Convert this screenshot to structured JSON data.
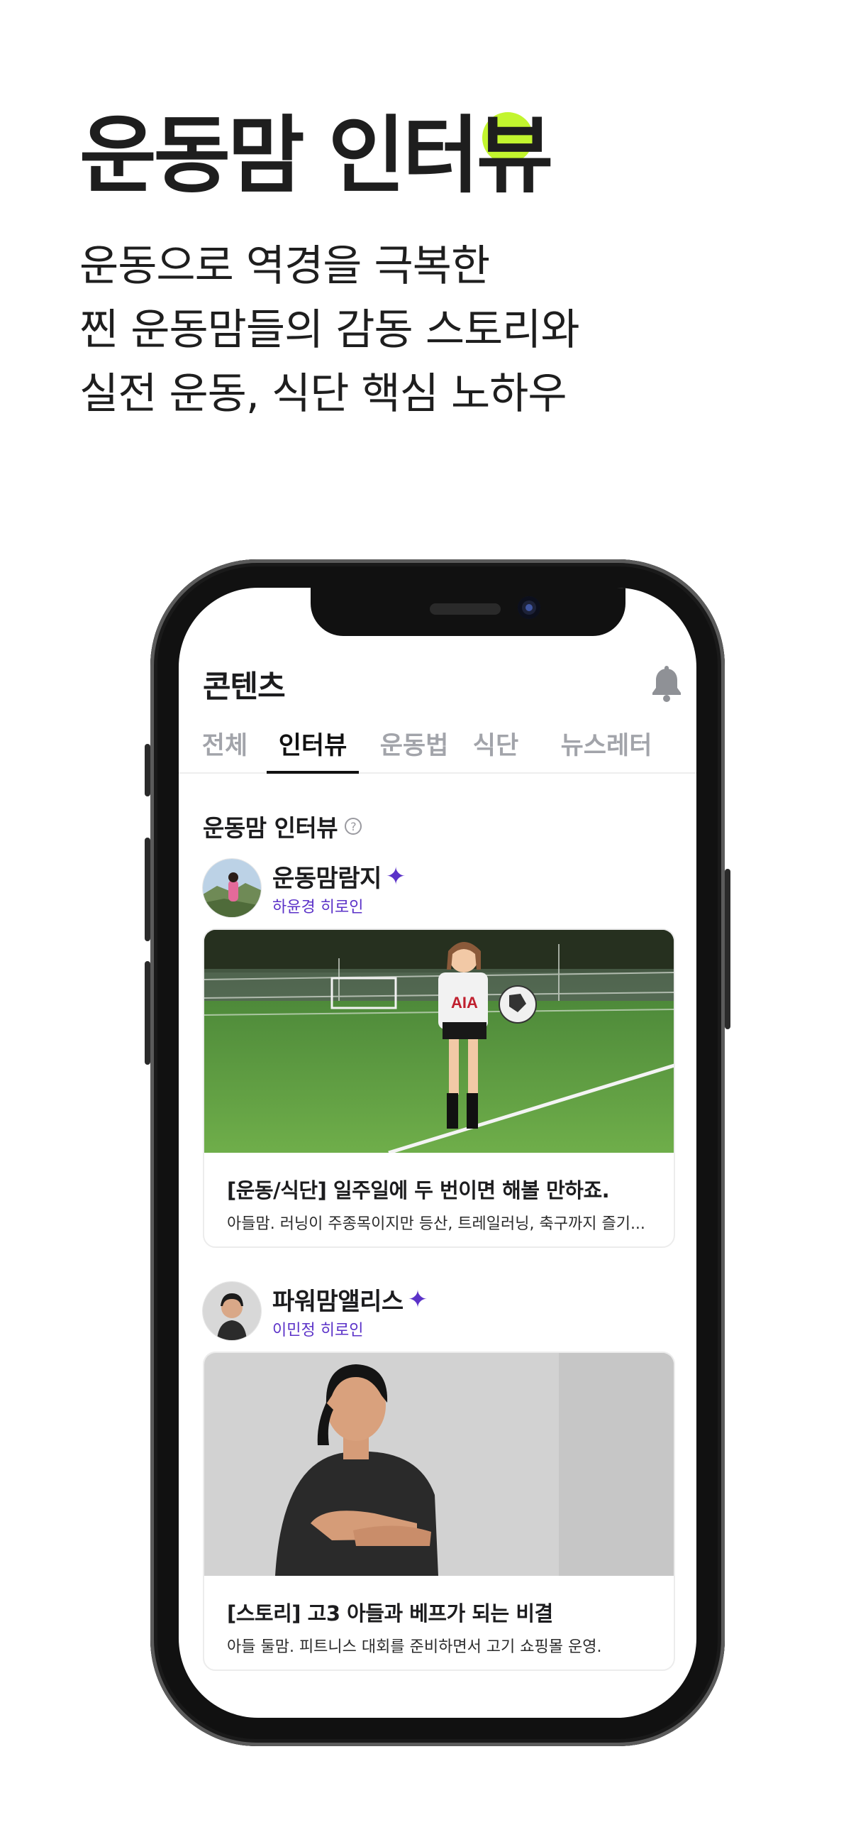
{
  "headline": {
    "title": "운동맘 인터뷰",
    "lines": [
      "운동으로 역경을 극복한",
      "찐 운동맘들의 감동 스토리와",
      "실전 운동, 식단 핵심 노하우"
    ]
  },
  "app": {
    "title": "콘텐츠",
    "tabs": [
      "전체",
      "인터뷰",
      "운동법",
      "식단",
      "뉴스레터"
    ],
    "active_tab": "인터뷰",
    "section_title": "운동맘 인터뷰",
    "help_glyph": "?",
    "sparkle_glyph": "✦"
  },
  "posts": [
    {
      "author_name": "운동맘람지",
      "author_sub": "하윤경 히로인",
      "title": "[운동/식단] 일주일에 두 번이면 해볼 만하죠.",
      "desc": "아들맘. 러닝이 주종목이지만 등산, 트레일러닝, 축구까지 즐기...",
      "jersey_text": "AIA"
    },
    {
      "author_name": "파워맘앨리스",
      "author_sub": "이민정 히로인",
      "title": "[스토리] 고3 아들과 베프가 되는 비결",
      "desc": "아들 둘맘. 피트니스 대회를 준비하면서 고기 쇼핑몰 운영."
    }
  ],
  "colors": {
    "accent_lime": "#c2f52e",
    "accent_purple": "#5b32c8",
    "text_dark": "#1c1c1e",
    "tab_inactive": "#a2a4aa"
  },
  "icons": {
    "notification": "bell-icon",
    "help": "help-circle-icon",
    "verified": "sparkle-icon"
  }
}
